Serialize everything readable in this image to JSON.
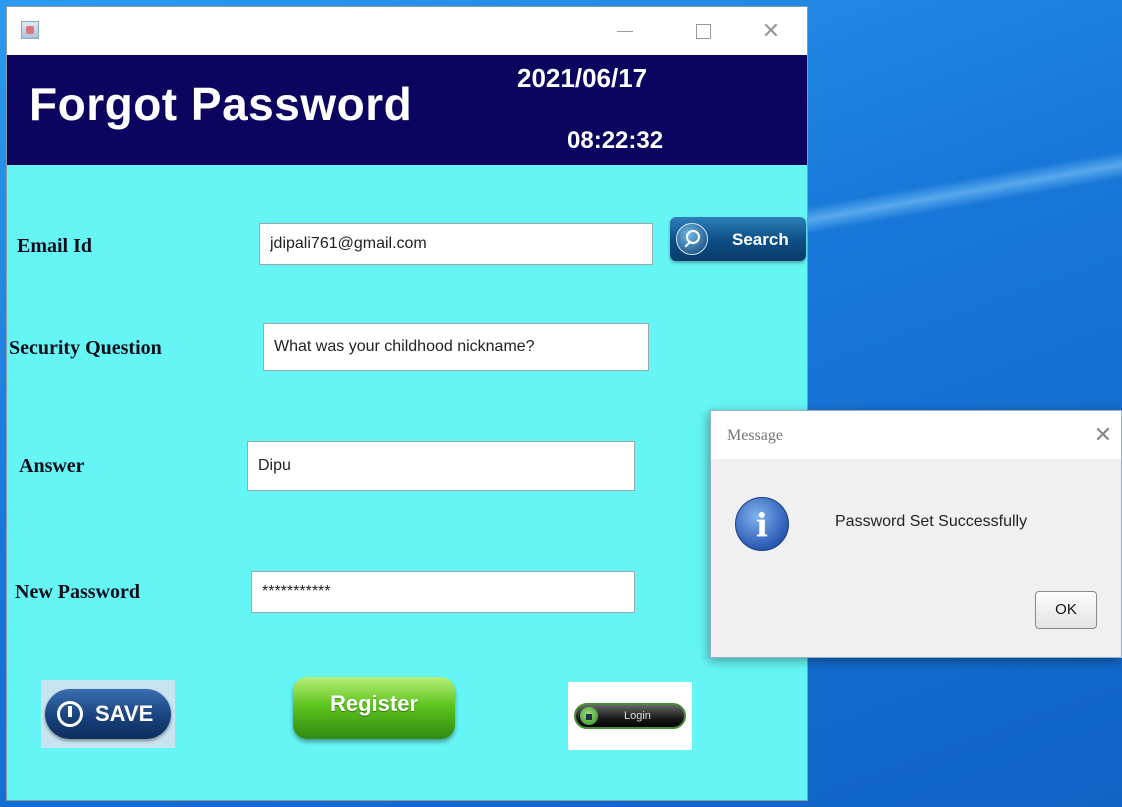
{
  "window": {
    "app_icon": "java-cup-icon",
    "controls": {
      "minimize": "—",
      "maximize": "☐",
      "close": "✕"
    }
  },
  "header": {
    "title": "Forgot Password",
    "date": "2021/06/17",
    "time": "08:22:32"
  },
  "form": {
    "email_label": "Email Id",
    "email_value": "jdipali761@gmail.com",
    "search_label": "Search",
    "security_label": "Security Question",
    "security_value": "What was your childhood nickname?",
    "answer_label": "Answer",
    "answer_value": "Dipu",
    "new_password_label": "New Password",
    "new_password_value": "***********"
  },
  "buttons": {
    "save": "SAVE",
    "register": "Register",
    "login": "Login"
  },
  "dialog": {
    "title": "Message",
    "close": "✕",
    "icon": "information-icon",
    "icon_glyph": "i",
    "message": "Password Set Successfully",
    "ok": "OK"
  },
  "colors": {
    "form_background": "#66f5f5",
    "header_background": "#0b0560",
    "desktop_background": "#1a7fd4"
  }
}
